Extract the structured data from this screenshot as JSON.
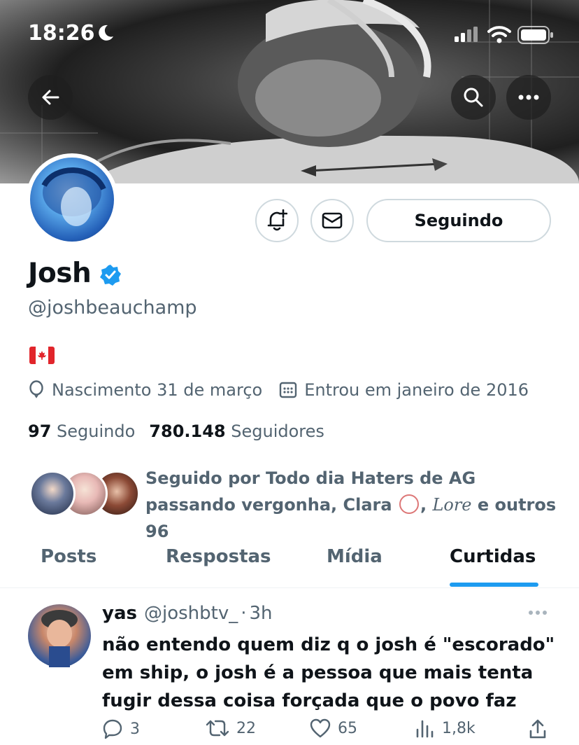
{
  "status_bar": {
    "time": "18:26"
  },
  "profile": {
    "name": "Josh",
    "handle": "@joshbeauchamp",
    "follow_label": "Seguindo",
    "bio_emoji": "🇨🇦",
    "birthday": "Nascimento 31 de março",
    "joined": "Entrou em janeiro de 2016",
    "following_count": "97",
    "following_label": "Seguindo",
    "followers_count": "780.148",
    "followers_label": "Seguidores",
    "followed_by": {
      "prefix": "Seguido por Todo dia Haters de AG passando vergonha, Clara",
      "sep": ",",
      "lore": "Lore",
      "suffix": "e outros 96"
    }
  },
  "tabs": [
    {
      "label": "Posts"
    },
    {
      "label": "Respostas"
    },
    {
      "label": "Mídia"
    },
    {
      "label": "Curtidas",
      "active": true
    }
  ],
  "tweet": {
    "name": "yas",
    "handle": "@joshbtv_",
    "dot": "·",
    "time": "3h",
    "text": "não entendo quem diz q o josh é \"escorado\" em ship, o josh é a pessoa que mais tenta fugir dessa coisa forçada que o povo faz",
    "replies": "3",
    "retweets": "22",
    "likes": "65",
    "views": "1,8k"
  },
  "colors": {
    "accent": "#1d9bf0",
    "muted": "#536471",
    "text": "#0f1419",
    "border": "#cfd9de"
  },
  "icons": [
    "back-arrow-icon",
    "search-icon",
    "more-icon",
    "notification-bell-icon",
    "mail-icon",
    "verified-badge-icon",
    "balloon-icon",
    "calendar-icon",
    "reply-icon",
    "retweet-icon",
    "like-icon",
    "views-icon",
    "share-icon"
  ]
}
